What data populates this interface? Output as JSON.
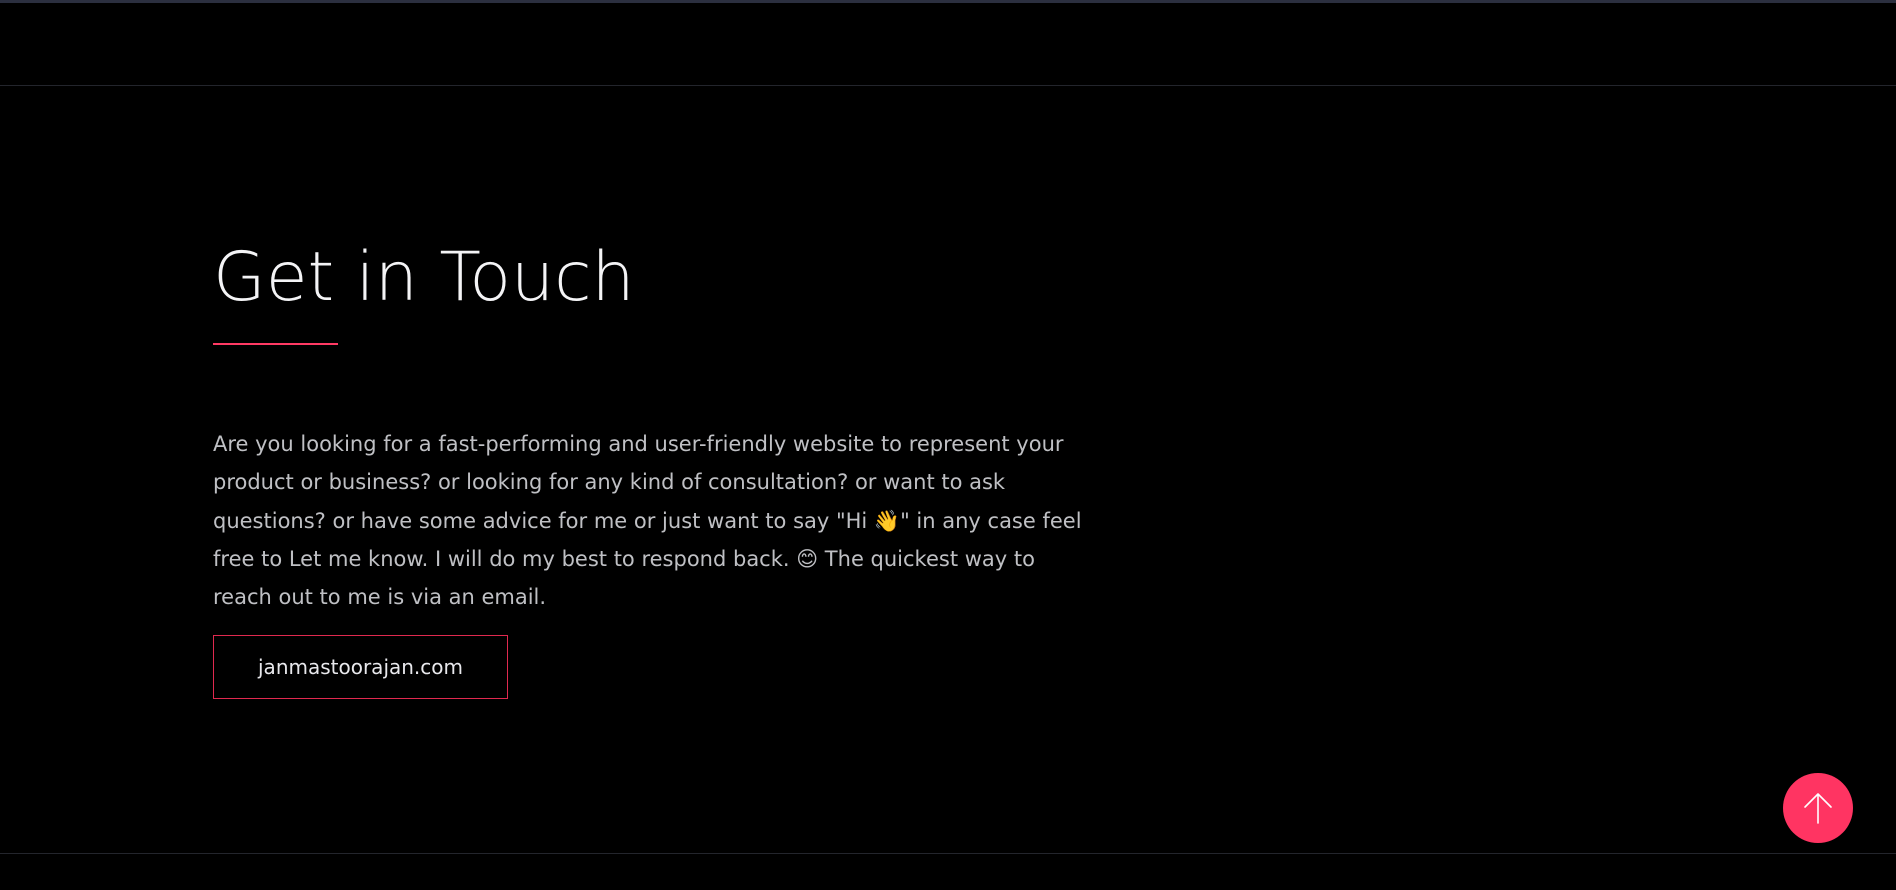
{
  "contact": {
    "title": "Get in Touch",
    "intro": "Are you looking for a fast-performing and user-friendly website to represent your product or business? or looking for any kind of consultation? or want to ask questions? or have some advice for me or just want to say \"Hi 👋\" in any case feel free to Let me know. I will do my best to respond back. 😊 The quickest way to reach out to me is via an email.",
    "email_button_label": "janmastoorajan.com"
  },
  "scroll_top": {
    "icon": "arrow-up-icon"
  },
  "colors": {
    "background": "#000000",
    "accent": "#ff3462",
    "text_primary": "#f4f4f6",
    "text_secondary": "#bfc0c4"
  }
}
